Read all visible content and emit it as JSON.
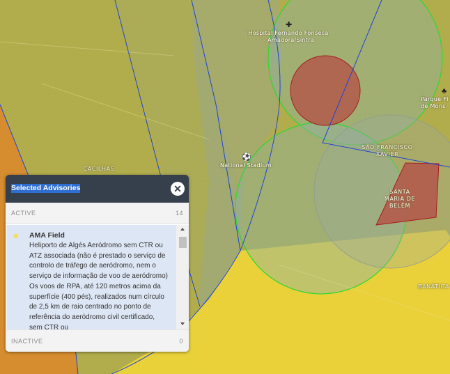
{
  "map": {
    "labels": {
      "hospital": "Hospital Fernando Fonseca",
      "hospital_sub": "– Amadora/Sintra",
      "parque_1": "Parque Fl",
      "parque_2": "de Mons",
      "sao_francisco_1": "SÃO FRANCISCO",
      "sao_francisco_2": "XAVIER",
      "cacilhas": "CACILHAS",
      "national_stadium": "National Stadium",
      "santa_1": "SANTA",
      "santa_2": "MARIA DE",
      "santa_3": "BELÉM",
      "banatica": "BANÁTICA"
    },
    "zone_colors": {
      "restricted_fill": "#b35b4c",
      "restricted_stroke": "#a21f1f",
      "airfield_circle": "#2ed82e",
      "boundary_line": "#1c44d6",
      "yellow_zone": "#f1d835",
      "orange_zone": "#e38a1f"
    }
  },
  "panel": {
    "title": "Selected Advisories",
    "close_icon": "close-icon",
    "active_label": "ACTIVE",
    "active_count": "14",
    "advisory": {
      "icon": "star-icon",
      "name": "AMA Field",
      "description": "Heliporto de Algés Aeródromo sem CTR ou ATZ associada (não é prestado o serviço de controlo de tráfego de aeródromo, nem o serviço de informação de voo de aeródromo) Os voos de RPA, até 120 metros acima da superfície (400 pés), realizados num círculo de 2,5 km de raio centrado no ponto de referência do aeródromo civil certificado, sem CTR ou"
    },
    "inactive_label": "INACTIVE",
    "inactive_count": "0"
  }
}
